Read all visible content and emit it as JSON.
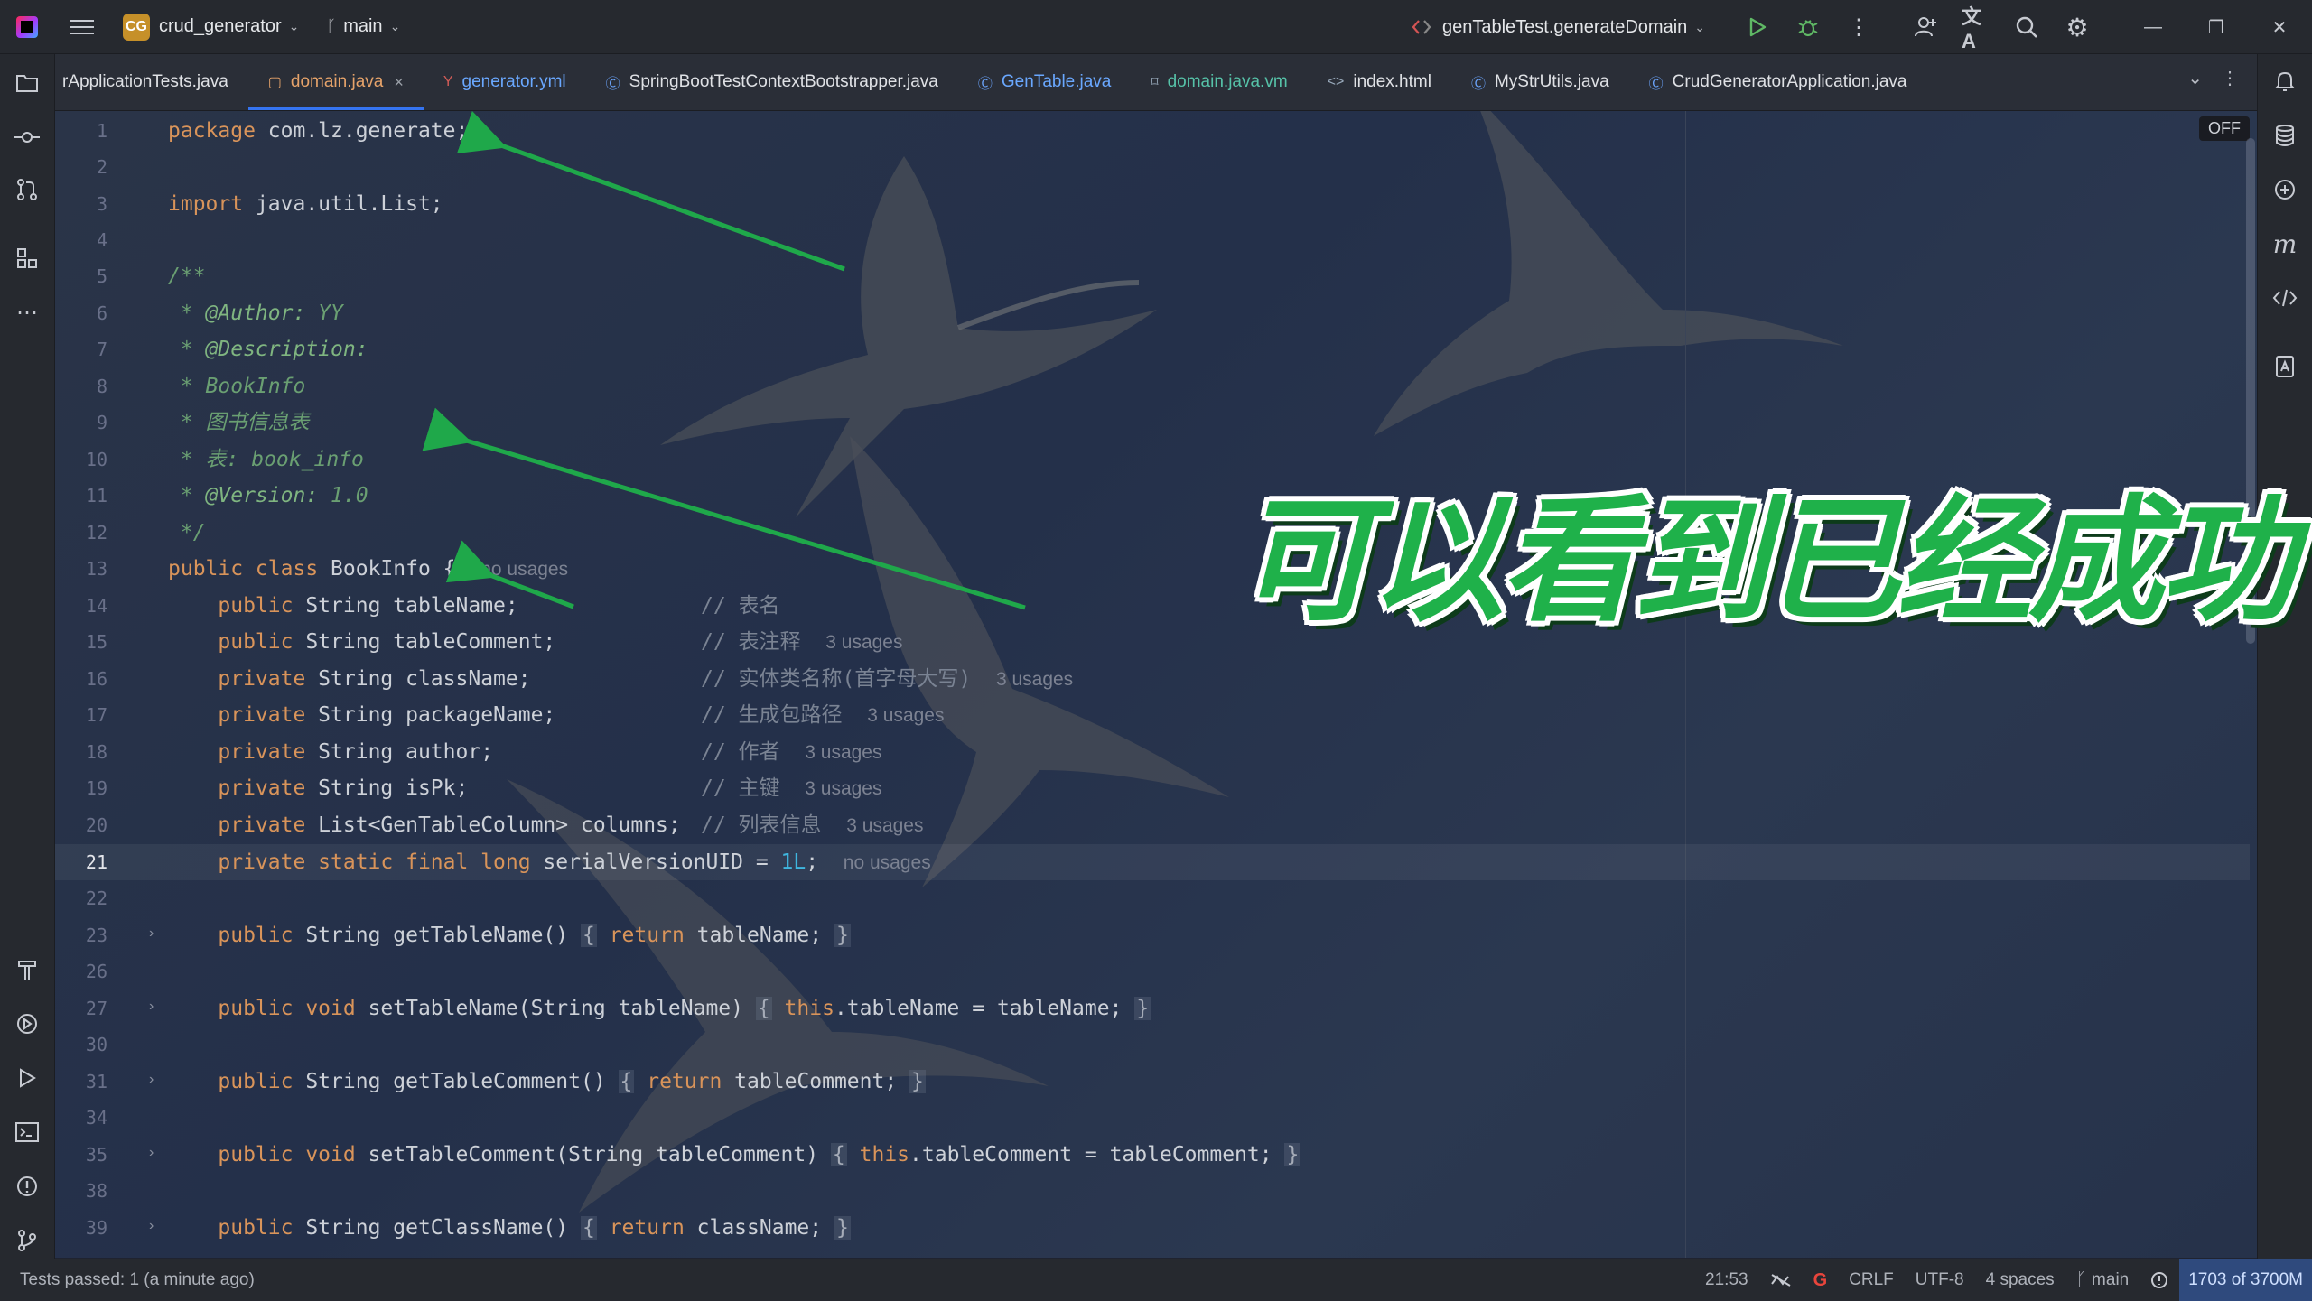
{
  "titlebar": {
    "project_badge": "CG",
    "project_name": "crud_generator",
    "branch": "main",
    "run_config": "genTableTest.generateDomain"
  },
  "tabs": [
    {
      "label": "rApplicationTests.java"
    },
    {
      "label": "domain.java",
      "active": true
    },
    {
      "label": "generator.yml"
    },
    {
      "label": "SpringBootTestContextBootstrapper.java"
    },
    {
      "label": "GenTable.java"
    },
    {
      "label": "domain.java.vm"
    },
    {
      "label": "index.html"
    },
    {
      "label": "MyStrUtils.java"
    },
    {
      "label": "CrudGeneratorApplication.java"
    }
  ],
  "editor": {
    "off_badge": "OFF",
    "line_numbers": [
      "1",
      "2",
      "3",
      "4",
      "5",
      "6",
      "7",
      "8",
      "9",
      "10",
      "11",
      "12",
      "13",
      "14",
      "15",
      "16",
      "17",
      "18",
      "19",
      "20",
      "21",
      "22",
      "23",
      "26",
      "27",
      "30",
      "31",
      "34",
      "35",
      "38",
      "39"
    ],
    "code": {
      "l1_kw": "package",
      "l1_rest": " com.lz.generate;",
      "l3_kw": "import",
      "l3_rest": " java.util.List;",
      "l5": "/**",
      "l6_tag": "@Author:",
      "l6_val": " YY",
      "l7_tag": "@Description:",
      "l8": "BookInfo",
      "l9": "图书信息表",
      "l10": "表: book_info",
      "l11_tag": "@Version:",
      "l11_val": " 1.0",
      "l12": " */",
      "l13_kw": "public class",
      "l13_rest": " BookInfo {",
      "l13_hint": "no usages",
      "fields": [
        {
          "mod": "public",
          "decl": " String tableName;",
          "comment": "// 表名",
          "hint": ""
        },
        {
          "mod": "public",
          "decl": " String tableComment;",
          "comment": "// 表注释",
          "hint": "3 usages"
        },
        {
          "mod": "private",
          "decl": " String className;",
          "comment": "// 实体类名称(首字母大写)",
          "hint": "3 usages"
        },
        {
          "mod": "private",
          "decl": " String packageName;",
          "comment": "// 生成包路径",
          "hint": "3 usages"
        },
        {
          "mod": "private",
          "decl": " String author;",
          "comment": "// 作者",
          "hint": "3 usages"
        },
        {
          "mod": "private",
          "decl": " String isPk;",
          "comment": "// 主键",
          "hint": "3 usages"
        },
        {
          "mod": "private",
          "decl": " List<GenTableColumn> columns;",
          "comment": "// 列表信息",
          "hint": "3 usages"
        }
      ],
      "l21_kw": "private static final long",
      "l21_rest": " serialVersionUID = ",
      "l21_num": "1L",
      "l21_end": ";",
      "l21_hint": "no usages",
      "methods": [
        {
          "sig_kw": "public",
          "sig": " String getTableName() ",
          "body_kw": "return",
          "body": " tableName; "
        },
        {
          "sig_kw": "public void",
          "sig": " setTableName(String tableName) ",
          "body_kw": "this",
          "body": ".tableName = tableName; "
        },
        {
          "sig_kw": "public",
          "sig": " String getTableComment() ",
          "body_kw": "return",
          "body": " tableComment; "
        },
        {
          "sig_kw": "public void",
          "sig": " setTableComment(String tableComment) ",
          "body_kw": "this",
          "body": ".tableComment = tableComment; "
        },
        {
          "sig_kw": "public",
          "sig": " String getClassName() ",
          "body_kw": "return",
          "body": " className; "
        }
      ]
    }
  },
  "overlay": {
    "caption": "可以看到已经成功",
    "caption_color": "#1fb14a",
    "arrow_color": "#1fa84a"
  },
  "statusbar": {
    "left": "Tests passed: 1 (a minute ago)",
    "position": "21:53",
    "line_ending": "CRLF",
    "encoding": "UTF-8",
    "indent": "4 spaces",
    "branch": "main",
    "memory": "1703 of 3700M"
  },
  "colors": {
    "accent": "#3574f0",
    "keyword": "#d9945a",
    "number": "#3fb6df",
    "doc_comment": "#6a9f72"
  }
}
